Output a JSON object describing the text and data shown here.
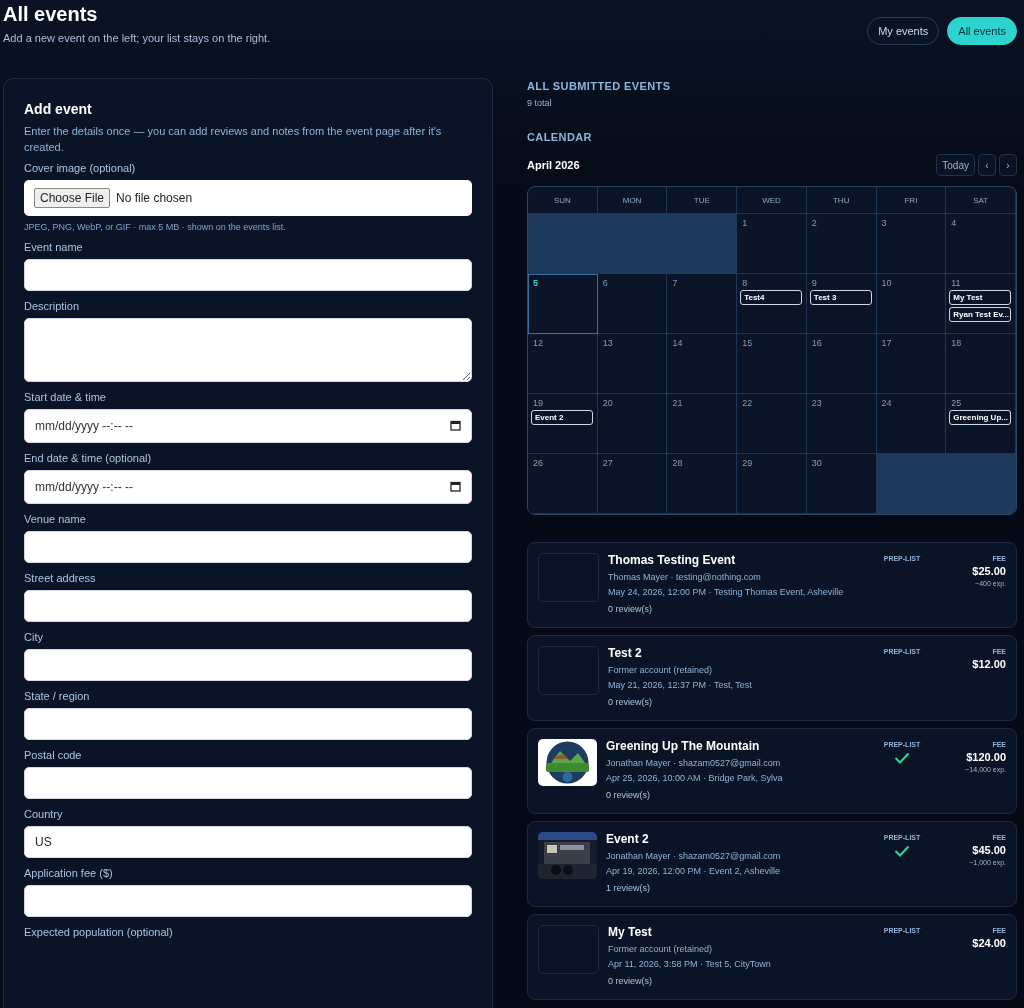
{
  "header": {
    "title": "All events",
    "subtitle": "Add a new event on the left; your list stays on the right."
  },
  "view_tabs": [
    {
      "label": "My events",
      "selected": false
    },
    {
      "label": "All events",
      "selected": true
    }
  ],
  "add_event": {
    "title": "Add event",
    "intro": "Enter the details once — you can add reviews and notes from the event page after it's created.",
    "fields": [
      {
        "kind": "file",
        "label": "Cover image (optional)",
        "button": "Choose File",
        "status": "No file chosen",
        "hint": "JPEG, PNG, WebP, or GIF · max 5 MB · shown on the events list."
      },
      {
        "kind": "text",
        "label": "Event name"
      },
      {
        "kind": "textarea",
        "label": "Description"
      },
      {
        "kind": "datetime",
        "label": "Start date & time",
        "placeholder": "mm/dd/yyyy --:-- --"
      },
      {
        "kind": "datetime",
        "label": "End date & time (optional)",
        "placeholder": "mm/dd/yyyy --:-- --"
      },
      {
        "kind": "text",
        "label": "Venue name"
      },
      {
        "kind": "text",
        "label": "Street address"
      },
      {
        "kind": "text",
        "label": "City"
      },
      {
        "kind": "text",
        "label": "State / region"
      },
      {
        "kind": "text",
        "label": "Postal code"
      },
      {
        "kind": "text",
        "label": "Country",
        "value": "US"
      },
      {
        "kind": "text",
        "label": "Application fee ($)"
      },
      {
        "kind": "label_only",
        "label": "Expected population (optional)"
      }
    ]
  },
  "submitted": {
    "heading": "ALL SUBMITTED EVENTS",
    "count": "9 total"
  },
  "calendar": {
    "heading": "CALENDAR",
    "month": "April 2026",
    "today_button": "Today",
    "prev": "‹",
    "next": "›",
    "weekdays": [
      "SUN",
      "MON",
      "TUE",
      "WED",
      "THU",
      "FRI",
      "SAT"
    ],
    "weeks": [
      [
        {
          "kind": "blank"
        },
        {
          "kind": "blank"
        },
        {
          "kind": "blank"
        },
        {
          "kind": "day",
          "day": "1",
          "today": false
        },
        {
          "kind": "day",
          "day": "2",
          "today": false
        },
        {
          "kind": "day",
          "day": "3",
          "today": false
        },
        {
          "kind": "day",
          "day": "4",
          "today": false
        }
      ],
      [
        {
          "kind": "day",
          "day": "5",
          "today": true
        },
        {
          "kind": "day",
          "day": "6",
          "today": false
        },
        {
          "kind": "day",
          "day": "7",
          "today": false
        },
        {
          "kind": "day",
          "day": "8",
          "today": false,
          "events": [
            "Test4"
          ]
        },
        {
          "kind": "day",
          "day": "9",
          "today": false,
          "events": [
            "Test 3"
          ]
        },
        {
          "kind": "day",
          "day": "10",
          "today": false
        },
        {
          "kind": "day",
          "day": "11",
          "today": false,
          "events": [
            "My Test",
            "Ryan Test Ev..."
          ]
        }
      ],
      [
        {
          "kind": "day",
          "day": "12",
          "today": false
        },
        {
          "kind": "day",
          "day": "13",
          "today": false
        },
        {
          "kind": "day",
          "day": "14",
          "today": false
        },
        {
          "kind": "day",
          "day": "15",
          "today": false
        },
        {
          "kind": "day",
          "day": "16",
          "today": false
        },
        {
          "kind": "day",
          "day": "17",
          "today": false
        },
        {
          "kind": "day",
          "day": "18",
          "today": false
        }
      ],
      [
        {
          "kind": "day",
          "day": "19",
          "today": false,
          "events": [
            "Event 2"
          ]
        },
        {
          "kind": "day",
          "day": "20",
          "today": false
        },
        {
          "kind": "day",
          "day": "21",
          "today": false
        },
        {
          "kind": "day",
          "day": "22",
          "today": false
        },
        {
          "kind": "day",
          "day": "23",
          "today": false
        },
        {
          "kind": "day",
          "day": "24",
          "today": false
        },
        {
          "kind": "day",
          "day": "25",
          "today": false,
          "events": [
            "Greening Up..."
          ]
        }
      ],
      [
        {
          "kind": "day",
          "day": "26",
          "today": false
        },
        {
          "kind": "day",
          "day": "27",
          "today": false
        },
        {
          "kind": "day",
          "day": "28",
          "today": false
        },
        {
          "kind": "day",
          "day": "29",
          "today": false
        },
        {
          "kind": "day",
          "day": "30",
          "today": false
        },
        {
          "kind": "blank"
        },
        {
          "kind": "blank"
        }
      ]
    ]
  },
  "events": [
    {
      "kind": "no_picture",
      "title": "Thomas Testing Event",
      "owner": "Thomas Mayer · testing@nothing.com",
      "when": "May 24, 2026, 12:00 PM · Testing Thomas Event, Asheville",
      "reviews": "0 review(s)",
      "prep_label": "PREP-LIST",
      "prep_done": false,
      "fee_label": "FEE",
      "fee": "$25.00",
      "expected": "~400 exp."
    },
    {
      "kind": "no_picture",
      "title": "Test 2",
      "owner": "Former account (retained)",
      "when": "May 21, 2026, 12:37 PM · Test, Test",
      "reviews": "0 review(s)",
      "prep_label": "PREP-LIST",
      "prep_done": false,
      "fee_label": "FEE",
      "fee": "$12.00"
    },
    {
      "kind": "picture",
      "title": "Greening Up The Mountain",
      "owner": "Jonathan Mayer · shazam0527@gmail.com",
      "when": "Apr 25, 2026, 10:00 AM · Bridge Park, Sylva",
      "reviews": "0 review(s)",
      "prep_label": "PREP-LIST",
      "prep_done": true,
      "fee_label": "FEE",
      "fee": "$120.00",
      "expected": "~14,000 exp."
    },
    {
      "kind": "picture",
      "title": "Event 2",
      "owner": "Jonathan Mayer · shazam0527@gmail.com",
      "when": "Apr 19, 2026, 12:00 PM · Event 2, Asheville",
      "reviews": "1 review(s)",
      "prep_label": "PREP-LIST",
      "prep_done": true,
      "fee_label": "FEE",
      "fee": "$45.00",
      "expected": "~1,000 exp."
    },
    {
      "kind": "no_picture",
      "title": "My Test",
      "owner": "Former account (retained)",
      "when": "Apr 11, 2026, 3:58 PM · Test 5, CityTown",
      "reviews": "0 review(s)",
      "prep_label": "PREP-LIST",
      "prep_done": false,
      "fee_label": "FEE",
      "fee": "$24.00"
    }
  ]
}
